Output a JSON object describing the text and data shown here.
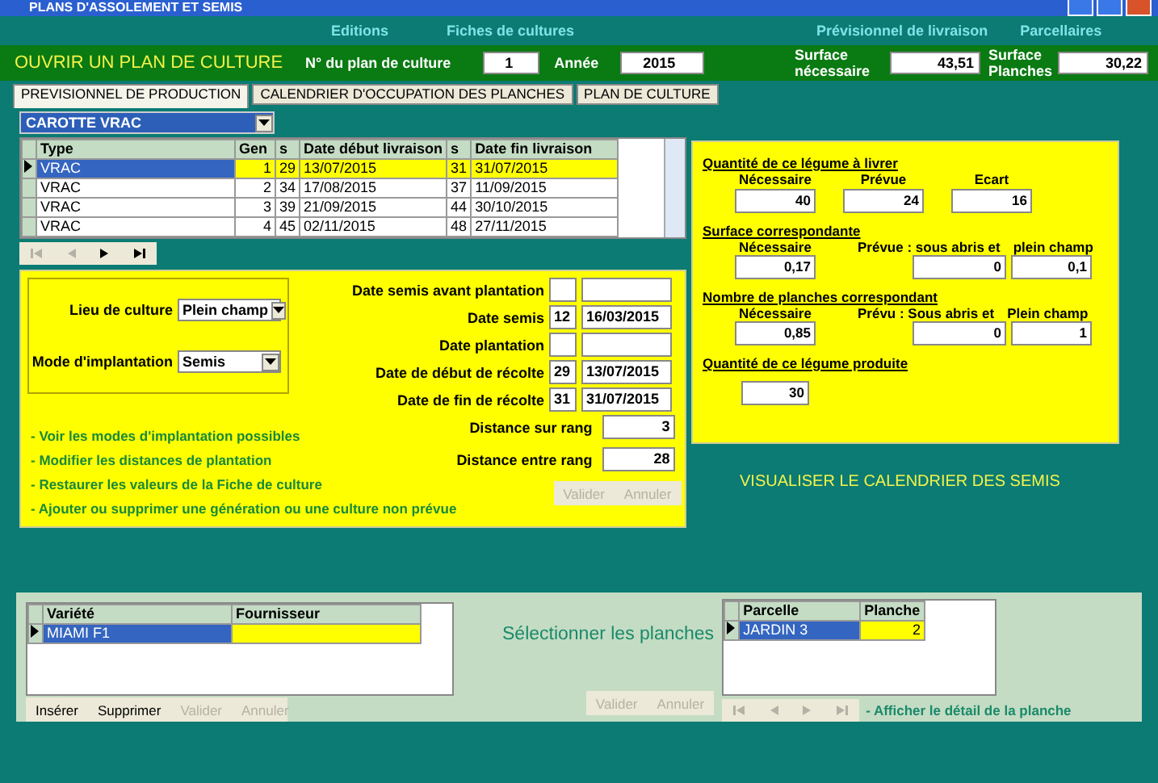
{
  "window": {
    "title": "PLANS D'ASSOLEMENT ET SEMIS"
  },
  "menu": [
    "Editions",
    "Fiches de cultures",
    "Prévisionnel de livraison",
    "Parcellaires"
  ],
  "header": {
    "title": "OUVRIR UN PLAN DE CULTURE",
    "plan_label": "N° du plan de culture",
    "plan_value": "1",
    "year_label": "Année",
    "year_value": "2015",
    "surface_needed_label": "Surface nécessaire",
    "surface_needed_value": "43,51",
    "surface_planches_label": "Surface Planches",
    "surface_planches_value": "30,22"
  },
  "tabs": [
    {
      "label": "PREVISIONNEL DE PRODUCTION",
      "selected": true
    },
    {
      "label": "CALENDRIER D'OCCUPATION DES PLANCHES",
      "selected": false
    },
    {
      "label": "PLAN DE CULTURE",
      "selected": false
    }
  ],
  "crop": {
    "value": "CAROTTE VRAC"
  },
  "generations": {
    "columns": [
      "Type",
      "Gen",
      "s",
      "Date début livraison",
      "s",
      "Date fin livraison"
    ],
    "rows": [
      {
        "cells": [
          "VRAC",
          "1",
          "29",
          "13/07/2015",
          "31",
          "31/07/2015"
        ],
        "selected": true
      },
      {
        "cells": [
          "VRAC",
          "2",
          "34",
          "17/08/2015",
          "37",
          "11/09/2015"
        ],
        "selected": false
      },
      {
        "cells": [
          "VRAC",
          "3",
          "39",
          "21/09/2015",
          "44",
          "30/10/2015"
        ],
        "selected": false
      },
      {
        "cells": [
          "VRAC",
          "4",
          "45",
          "02/11/2015",
          "48",
          "27/11/2015"
        ],
        "selected": false
      }
    ]
  },
  "nav": [
    {
      "kind": "first",
      "disabled": true
    },
    {
      "kind": "prev",
      "disabled": true
    },
    {
      "kind": "next",
      "disabled": false
    },
    {
      "kind": "last",
      "disabled": false
    }
  ],
  "culture": {
    "lieu_label": "Lieu de culture",
    "lieu_value": "Plein champ",
    "mode_label": "Mode d'implantation",
    "mode_value": "Semis",
    "dates": [
      {
        "label": "Date semis avant plantation"
      },
      {
        "label": "Date semis",
        "week": "12",
        "date": "16/03/2015"
      },
      {
        "label": "Date plantation"
      },
      {
        "label": "Date de début de récolte",
        "week": "29",
        "date": "13/07/2015"
      },
      {
        "label": "Date de fin de récolte",
        "week": "31",
        "date": "31/07/2015"
      }
    ],
    "distances": [
      {
        "label": "Distance sur rang",
        "value": "3"
      },
      {
        "label": "Distance entre rang",
        "value": "28"
      }
    ],
    "links": [
      "- Voir les modes d'implantation possibles",
      "- Modifier les distances de plantation",
      "- Restaurer les valeurs de la Fiche de culture",
      "- Ajouter ou supprimer une génération ou une culture non prévue"
    ],
    "buttons": [
      {
        "label": "Valider",
        "disabled": true
      },
      {
        "label": "Annuler",
        "disabled": true
      }
    ]
  },
  "quantities": {
    "livrer": {
      "title": "Quantité de ce légume à livrer",
      "labels": [
        "Nécessaire",
        "Prévue",
        "Ecart"
      ],
      "values": [
        "40",
        "24",
        "16"
      ]
    },
    "surface": {
      "title": "Surface correspondante",
      "labels": [
        "Nécessaire",
        "Prévue :  sous abris  et",
        "plein champ"
      ],
      "values": [
        "0,17",
        "0",
        "0,1"
      ]
    },
    "planches": {
      "title": "Nombre de planches correspondant",
      "labels": [
        "Nécessaire",
        "Prévu  :  Sous abris  et",
        "Plein champ"
      ],
      "values": [
        "0,85",
        "0",
        "1"
      ]
    },
    "produite": {
      "title": "Quantité de ce légume produite",
      "value": "30"
    }
  },
  "calendar_link": "VISUALISER LE CALENDRIER DES SEMIS",
  "varieties": {
    "columns": [
      "Variété",
      "Fournisseur"
    ],
    "rows": [
      {
        "cells": [
          "MIAMI F1",
          ""
        ],
        "selected": true
      }
    ],
    "buttons": [
      {
        "label": "Insérer",
        "disabled": false
      },
      {
        "label": "Supprimer",
        "disabled": false
      },
      {
        "label": "Valider",
        "disabled": true
      },
      {
        "label": "Annuler",
        "disabled": true
      }
    ]
  },
  "select_planches": {
    "label": "Sélectionner les planches",
    "buttons": [
      {
        "label": "Valider",
        "disabled": true
      },
      {
        "label": "Annuler",
        "disabled": true
      }
    ]
  },
  "parcels": {
    "columns": [
      "Parcelle",
      "Planche"
    ],
    "rows": [
      {
        "cells": [
          "JARDIN 3",
          "2"
        ],
        "selected": true
      }
    ],
    "nav": [
      {
        "kind": "first",
        "disabled": true
      },
      {
        "kind": "prev",
        "disabled": true
      },
      {
        "kind": "next",
        "disabled": true
      },
      {
        "kind": "last",
        "disabled": true
      }
    ],
    "detail_link": "- Afficher le détail de la planche"
  }
}
